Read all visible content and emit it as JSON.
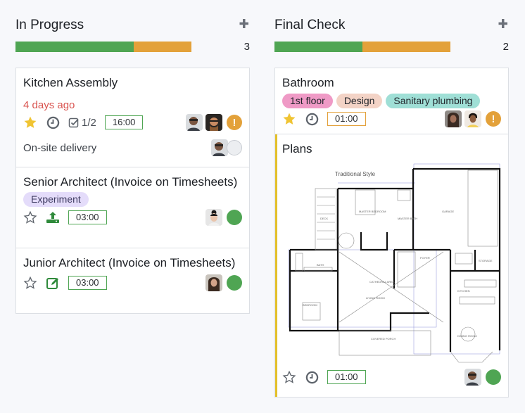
{
  "columns": [
    {
      "title": "In Progress",
      "count": "3",
      "add_icon": "plus-icon",
      "progress": {
        "green_fraction": 0.67,
        "orange_fraction": 0.33
      },
      "cards": [
        {
          "title": "Kitchen Assembly",
          "deadline": "4 days ago",
          "starred": true,
          "checklist": "1/2",
          "time": "16:00",
          "activity": "On-site delivery",
          "status": "warning"
        },
        {
          "title": "Senior Architect (Invoice on Timesheets)",
          "tag": "Experiment",
          "starred": false,
          "time": "03:00",
          "status": "done"
        },
        {
          "title": "Junior Architect (Invoice on Timesheets)",
          "starred": false,
          "time": "03:00",
          "status": "done"
        }
      ]
    },
    {
      "title": "Final Check",
      "count": "2",
      "add_icon": "plus-icon",
      "progress": {
        "green_fraction": 0.5,
        "orange_fraction": 0.5
      },
      "cards": [
        {
          "title": "Bathroom",
          "tags": [
            {
              "label": "1st floor",
              "color": "#ef9ac6"
            },
            {
              "label": "Design",
              "color": "#f3d3c6"
            },
            {
              "label": "Sanitary plumbing",
              "color": "#9fdfd6"
            }
          ],
          "starred": true,
          "time": "01:00",
          "status": "warning"
        },
        {
          "title": "Plans",
          "image_caption": "Traditional Style",
          "image_rooms": [
            "DECK",
            "MASTER BEDROOM",
            "MASTER BATH",
            "GARAGE",
            "BATH",
            "FOYER",
            "STORAGE",
            "CATHEDRAL AREA",
            "KITCHEN",
            "LIVING ROOM",
            "BEDROOM",
            "DINING ROOM",
            "COVERED PORCH"
          ],
          "starred": false,
          "time": "01:00",
          "status": "done"
        }
      ]
    }
  ],
  "colors": {
    "green": "#4fa553",
    "orange": "#e3a13a",
    "overdue": "#d9534f",
    "experiment_tag": "#e4dcfa",
    "plans_accent": "#e3c02a"
  }
}
